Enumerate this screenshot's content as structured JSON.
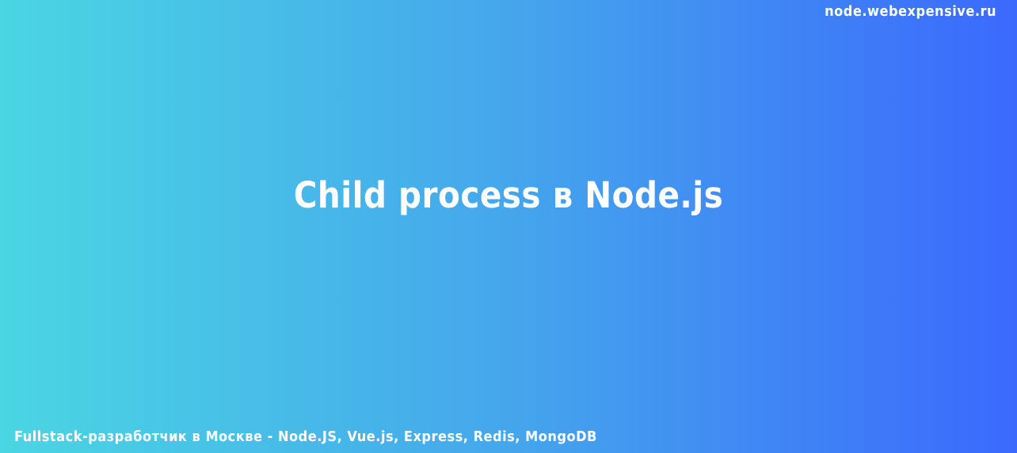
{
  "header": {
    "site_url": "node.webexpensive.ru"
  },
  "main": {
    "title": "Child process в Node.js"
  },
  "footer": {
    "tagline": "Fullstack-разработчик в Москве - Node.JS, Vue.js, Express, Redis, MongoDB"
  },
  "colors": {
    "gradient_start": "#4ad6e3",
    "gradient_end": "#3b69fd",
    "text": "#ffffff"
  }
}
